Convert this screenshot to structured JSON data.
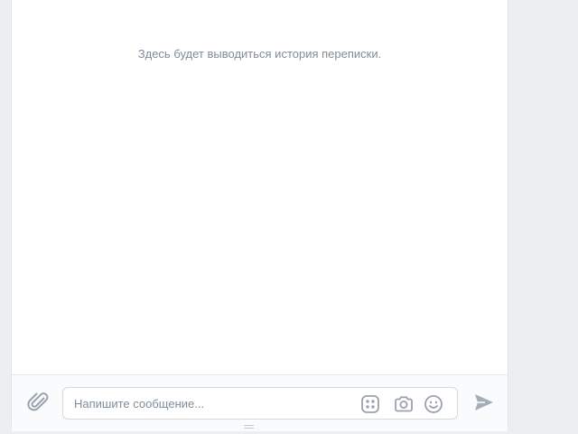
{
  "chat": {
    "empty_history_text": "Здесь будет выводиться история переписки."
  },
  "composer": {
    "placeholder": "Напишите сообщение...",
    "value": "",
    "icons": {
      "attach": "paperclip-icon",
      "stickers": "sticker-grid-icon",
      "camera": "camera-icon",
      "emoji": "smile-icon",
      "send": "send-arrow-icon"
    }
  },
  "colors": {
    "background": "#edeef0",
    "panel": "#ffffff",
    "muted_text": "#818c99",
    "icon": "#99a2ad",
    "border": "#d3d9de"
  }
}
